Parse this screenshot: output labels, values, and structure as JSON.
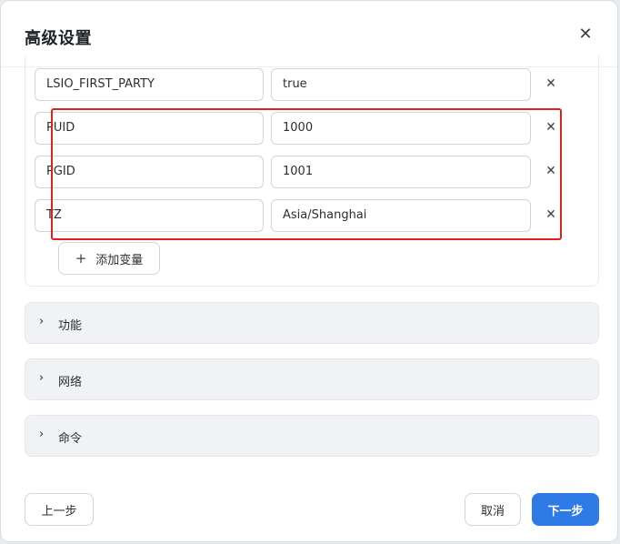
{
  "dialog": {
    "title": "高级设置",
    "close_icon": "close-icon"
  },
  "env": {
    "rows": [
      {
        "key": "LSIO_FIRST_PARTY",
        "value": "true"
      },
      {
        "key": "PUID",
        "value": "1000"
      },
      {
        "key": "PGID",
        "value": "1001"
      },
      {
        "key": "TZ",
        "value": "Asia/Shanghai"
      }
    ],
    "add_label": "添加变量",
    "highlight_color": "#e0201c"
  },
  "sections": [
    {
      "label": "功能",
      "icon": "chevron-right-icon"
    },
    {
      "label": "网络",
      "icon": "chevron-right-icon"
    },
    {
      "label": "命令",
      "icon": "chevron-right-icon"
    }
  ],
  "footer": {
    "prev_label": "上一步",
    "cancel_label": "取消",
    "next_label": "下一步",
    "primary_color": "#2f7be6"
  }
}
